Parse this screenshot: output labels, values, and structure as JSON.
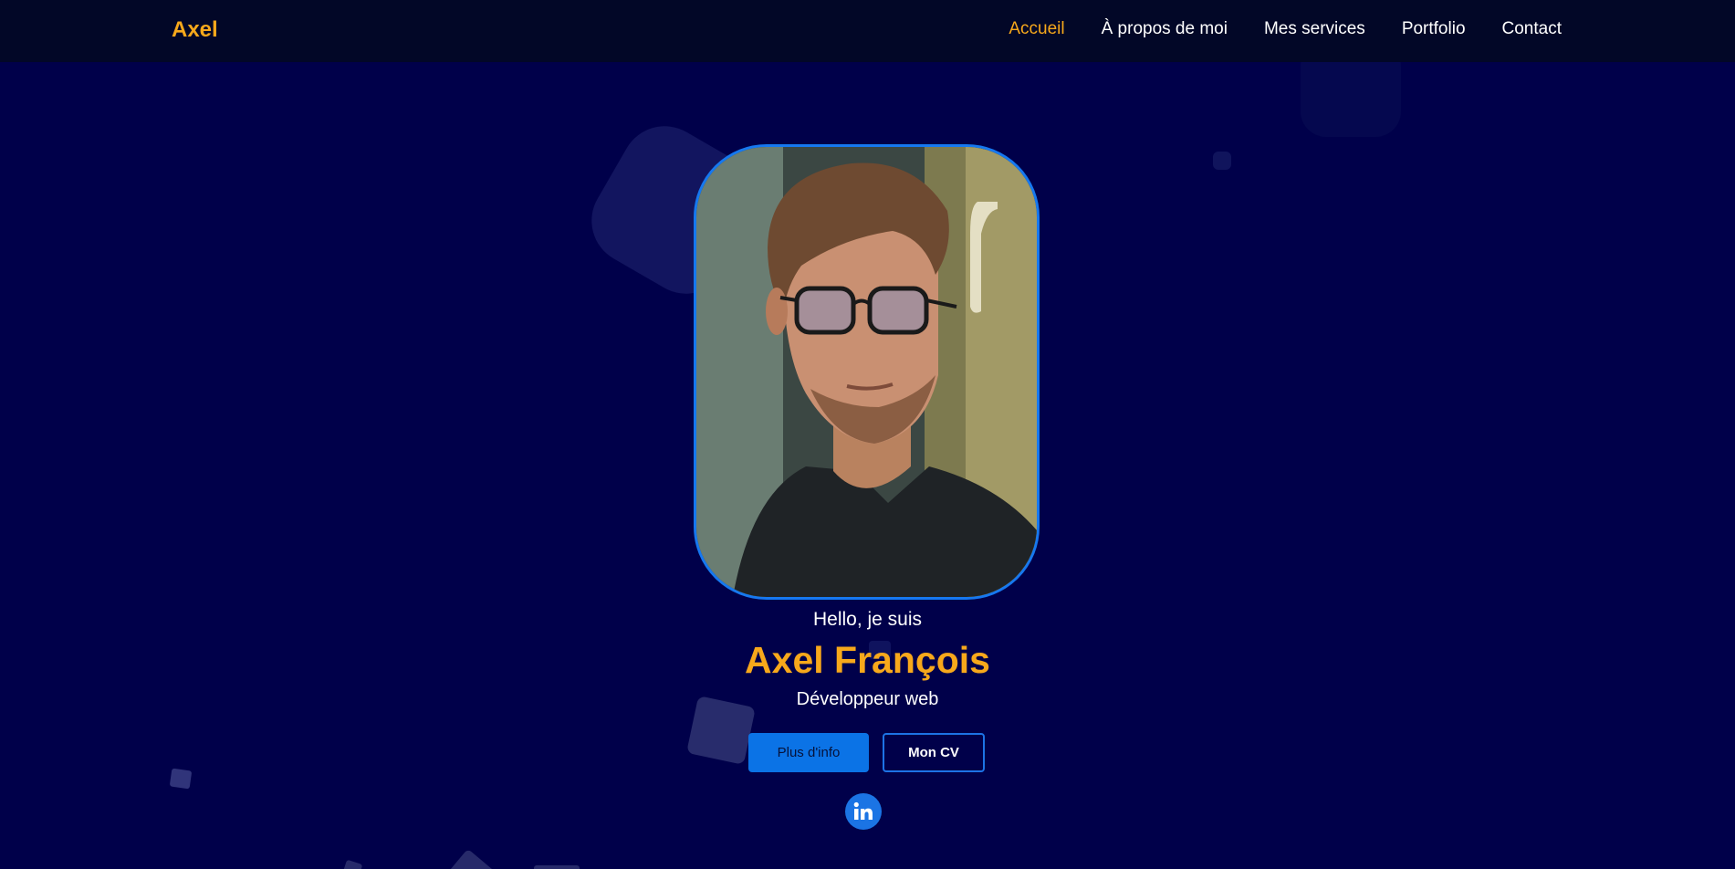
{
  "nav": {
    "brand": "Axel",
    "links": [
      {
        "label": "Accueil",
        "active": true
      },
      {
        "label": "À propos de moi",
        "active": false
      },
      {
        "label": "Mes services",
        "active": false
      },
      {
        "label": "Portfolio",
        "active": false
      },
      {
        "label": "Contact",
        "active": false
      }
    ]
  },
  "hero": {
    "greeting": "Hello, je suis",
    "name": "Axel François",
    "role": "Développeur web",
    "buttons": {
      "primary": "Plus d'info",
      "secondary": "Mon CV"
    },
    "social": [
      {
        "icon": "linkedin-icon"
      }
    ],
    "portrait": {
      "subject": "portrait photo"
    }
  },
  "colors": {
    "background": "#00004a",
    "navbar": "#020727",
    "accent": "#f7a81b",
    "primary_button": "#0b73e6",
    "portrait_border": "#1678f0"
  }
}
